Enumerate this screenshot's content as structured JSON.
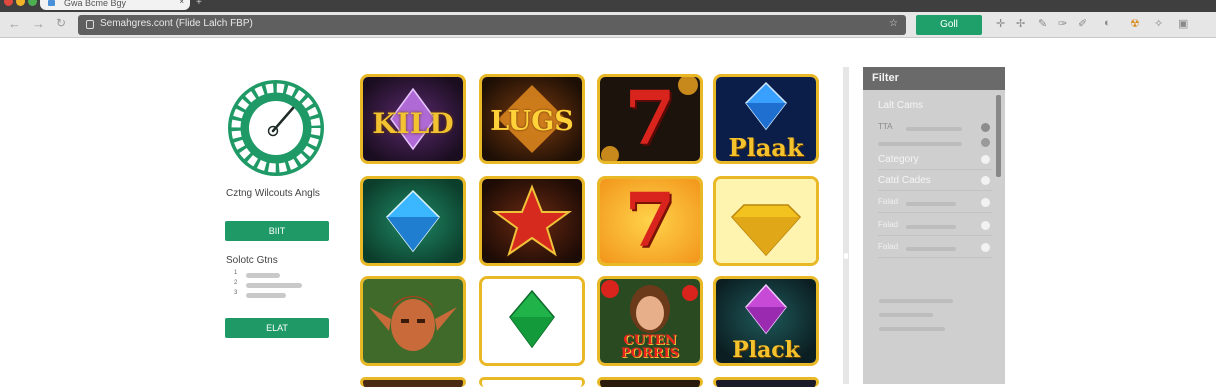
{
  "browser": {
    "tab_title": "Gwa Bcme Bgy",
    "url": "Semahgres.cont (Flide Lalch FBP)",
    "go_button": "Goll"
  },
  "left_panel": {
    "title": "Cztng Wilcouts Angls",
    "primary_button": "BIIT",
    "list_heading": "Solotc Gtns",
    "list_numbers": [
      "1",
      "2",
      "3"
    ],
    "secondary_button": "ELAT"
  },
  "games": [
    {
      "name": "KILD",
      "theme": "wild-gem"
    },
    {
      "name": "LUGS",
      "theme": "gold-text"
    },
    {
      "name": "7",
      "theme": "red-seven-dark"
    },
    {
      "name": "Plaak",
      "theme": "blue-gem"
    },
    {
      "name": "",
      "theme": "blue-diamond-green"
    },
    {
      "name": "",
      "theme": "red-star"
    },
    {
      "name": "7",
      "theme": "red-seven-orange"
    },
    {
      "name": "",
      "theme": "yellow-diamond"
    },
    {
      "name": "",
      "theme": "elf-portrait"
    },
    {
      "name": "",
      "theme": "green-emerald"
    },
    {
      "name": "CUTEN PORRIS",
      "theme": "woman-portrait"
    },
    {
      "name": "Plack",
      "theme": "purple-gem"
    }
  ],
  "filter": {
    "title": "Filter",
    "rows": [
      {
        "label": "Lalt Cams",
        "type": "header"
      },
      {
        "label": "TTA",
        "type": "slider"
      },
      {
        "label": "",
        "type": "slider"
      },
      {
        "label": "Category",
        "type": "option"
      },
      {
        "label": "Catd Cades",
        "type": "option"
      },
      {
        "label": "Falad",
        "type": "option"
      },
      {
        "label": "Falad",
        "type": "option"
      },
      {
        "label": "Falad",
        "type": "option"
      }
    ]
  },
  "colors": {
    "accent_green": "#1f9a66",
    "tile_border": "#e9b826",
    "filter_header": "#6a6a6a"
  }
}
